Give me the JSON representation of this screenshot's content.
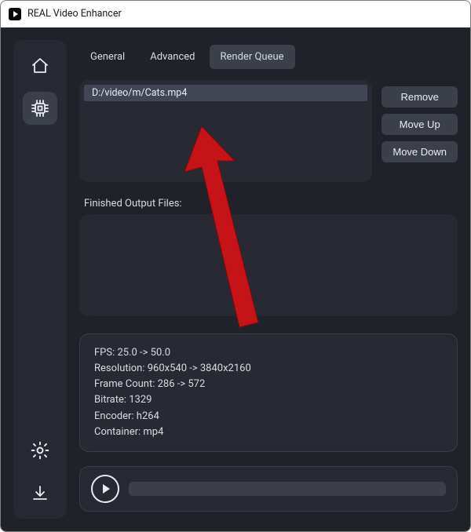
{
  "window": {
    "title": "REAL Video Enhancer"
  },
  "tabs": {
    "general": "General",
    "advanced": "Advanced",
    "render_queue": "Render Queue"
  },
  "queue": {
    "items": [
      "D:/video/m/Cats.mp4"
    ],
    "remove_label": "Remove",
    "moveup_label": "Move Up",
    "movedown_label": "Move Down"
  },
  "finished": {
    "label": "Finished Output Files:"
  },
  "details": {
    "fps": "FPS: 25.0 -> 50.0",
    "resolution": "Resolution: 960x540 -> 3840x2160",
    "frame_count": "Frame Count: 286 -> 572",
    "bitrate": "Bitrate: 1329",
    "encoder": "Encoder: h264",
    "container": "Container: mp4"
  }
}
